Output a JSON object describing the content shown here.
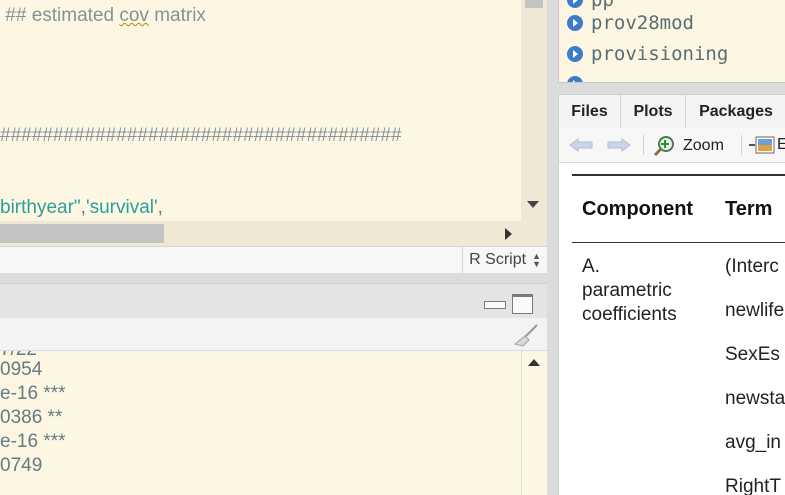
{
  "editor": {
    "lines": [
      {
        "comment": " ## estimated ",
        "squiggle": "cov",
        "rest": " matrix"
      },
      {
        "hashes": "######################################"
      },
      {
        "str1": "birthyear\"",
        "plain": ",",
        "str2": "'survival'",
        "tail": ","
      }
    ],
    "language": "R Script"
  },
  "console": {
    "lines": [
      "7/22",
      "0954",
      "e-16 ***",
      "0386 **",
      "e-16 ***",
      "0749"
    ]
  },
  "environment": {
    "items": [
      {
        "name": "pp",
        "icon": "play-circle-icon"
      },
      {
        "name": "prov28mod",
        "icon": "play-circle-icon"
      },
      {
        "name": "provisioning",
        "icon": "play-circle-icon"
      },
      {
        "name": "",
        "icon": "play-circle-icon"
      }
    ]
  },
  "files_pane": {
    "tabs": [
      "Files",
      "Plots",
      "Packages"
    ],
    "toolbar": {
      "zoom_label": "Zoom",
      "export_label": "E"
    }
  },
  "viewer_table": {
    "headers": [
      "Component",
      "Term"
    ],
    "component": [
      "A.",
      "parametric",
      "coefficients"
    ],
    "terms": [
      "(Interc",
      "newlife",
      "SexEs",
      "newsta",
      "avg_in",
      "RightT"
    ]
  },
  "colors": {
    "editor_bg": "#fdf6e3",
    "comment": "#839496",
    "string": "#2aa198",
    "env_icon": "#3d7cc9"
  }
}
